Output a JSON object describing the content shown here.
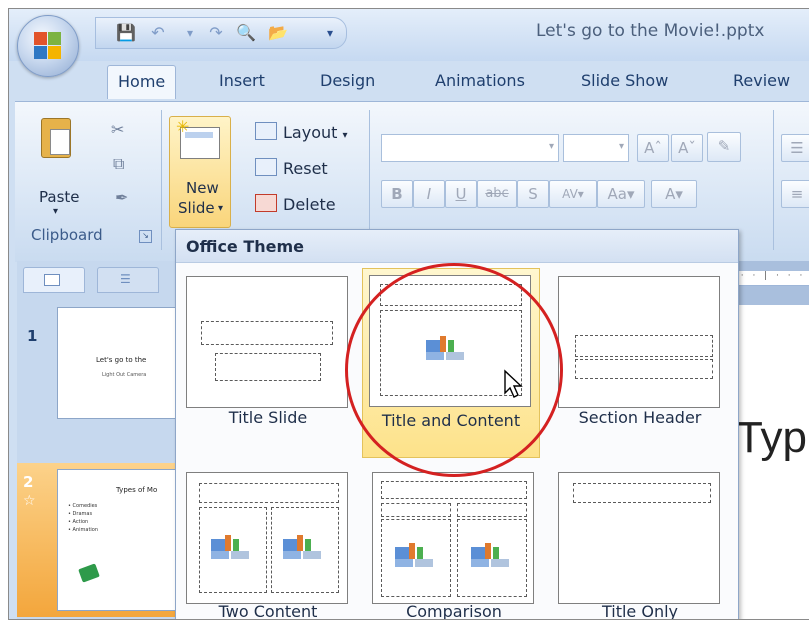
{
  "title_bar": {
    "document_title": "Let's go to the Movie!.pptx"
  },
  "tabs": [
    {
      "label": "Home",
      "active": true
    },
    {
      "label": "Insert",
      "active": false
    },
    {
      "label": "Design",
      "active": false
    },
    {
      "label": "Animations",
      "active": false
    },
    {
      "label": "Slide Show",
      "active": false
    },
    {
      "label": "Review",
      "active": false
    }
  ],
  "ribbon": {
    "paste_label": "Paste",
    "new_slide_line1": "New",
    "new_slide_line2": "Slide",
    "layout_label": "Layout",
    "reset_label": "Reset",
    "delete_label": "Delete",
    "clipboard_group": "Clipboard"
  },
  "gallery": {
    "title": "Office Theme",
    "items": [
      {
        "label": "Title Slide"
      },
      {
        "label": "Title and Content",
        "highlighted": true
      },
      {
        "label": "Section Header"
      },
      {
        "label": "Two Content"
      },
      {
        "label": "Comparison"
      },
      {
        "label": "Title Only"
      }
    ]
  },
  "slides": [
    {
      "number": "1",
      "title": "Let's go to the",
      "subtitle": "Light Out Camera"
    },
    {
      "number": "2",
      "title": "Types of Mo",
      "bullets": [
        "Comedies",
        "Dramas",
        "Action",
        "Animation"
      ]
    }
  ],
  "slide_editor": {
    "visible_title": "Typ"
  },
  "colors": {
    "highlight": "#fde28a",
    "circle": "#d42121",
    "selected_slide": "#f3a63c"
  }
}
